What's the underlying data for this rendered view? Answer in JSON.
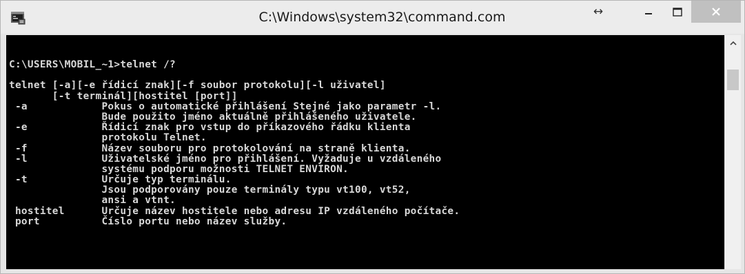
{
  "window": {
    "title": "C:\\Windows\\system32\\command.com",
    "resize_glyph": "↔",
    "colors": {
      "titlebar": "#ececec",
      "close_button": "#c0c0c0",
      "console_bg": "#000000",
      "console_text": "#d8d8d8"
    },
    "icons": {
      "app": "console-app-icon",
      "minimize": "minimize-icon",
      "maximize": "maximize-icon",
      "close": "close-icon",
      "scroll_up": "scroll-up-arrow-icon"
    }
  },
  "console": {
    "lines": [
      "C:\\USERS\\MOBIL_~1>telnet /?",
      "",
      "telnet [-a][-e řídicí znak][-f soubor protokolu][-l uživatel]",
      "       [-t terminál][hostitel [port]]",
      " -a            Pokus o automatické přihlášení Stejné jako parametr -l.",
      "               Bude použito jméno aktuálně přihlášeného uživatele.",
      " -e            Řídicí znak pro vstup do příkazového řádku klienta",
      "               protokolu Telnet.",
      " -f            Název souboru pro protokolování na straně klienta.",
      " -l            Uživatelské jméno pro přihlášení. Vyžaduje u vzdáleného",
      "               systému podporu možnosti TELNET ENVIRON.",
      " -t            Určuje typ terminálu.",
      "               Jsou podporovány pouze terminály typu vt100, vt52,",
      "               ansi a vtnt.",
      " hostitel      Určuje název hostitele nebo adresu IP vzdáleného počítače.",
      " port          Číslo portu nebo název služby."
    ]
  }
}
